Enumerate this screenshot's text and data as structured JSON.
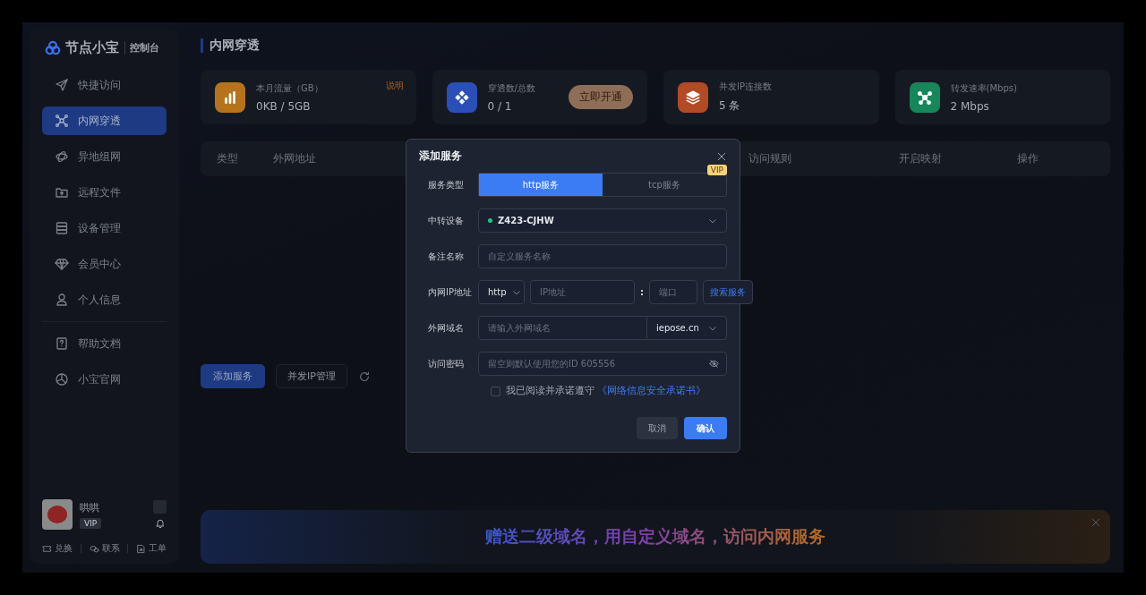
{
  "sidebar": {
    "logo": {
      "name": "节点小宝",
      "suffix": "控制台"
    },
    "items": [
      {
        "label": "快捷访问",
        "selected": false
      },
      {
        "label": "内网穿透",
        "selected": true
      },
      {
        "label": "异地组网",
        "selected": false
      },
      {
        "label": "远程文件",
        "selected": false
      },
      {
        "label": "设备管理",
        "selected": false
      },
      {
        "label": "会员中心",
        "selected": false
      },
      {
        "label": "个人信息",
        "selected": false
      }
    ],
    "help_items": [
      {
        "label": "帮助文档",
        "selected": false
      },
      {
        "label": "小宝官网",
        "selected": false
      }
    ],
    "user": {
      "name": "哄哄",
      "badge": "VIP"
    },
    "footer_links": [
      "兑换",
      "联系",
      "工单"
    ]
  },
  "page_title": "内网穿透",
  "stats": [
    {
      "label": "本月流量（GB）",
      "value": "0KB / 5GB",
      "color": "#b5741b",
      "action_link": "说明"
    },
    {
      "label": "穿透数/总数",
      "value": "0 / 1",
      "color": "#2b4fb8",
      "action_button": "立即开通"
    },
    {
      "label": "并发IP连接数",
      "value": "5 条",
      "color": "#b24a26"
    },
    {
      "label": "转发速率(Mbps)",
      "value": "2 Mbps",
      "color": "#17865a"
    }
  ],
  "table": {
    "columns": [
      "类型",
      "外网地址",
      "访问规则",
      "开启映射",
      "操作"
    ]
  },
  "actions": {
    "add_button": "添加服务",
    "ip_button": "并发IP管理"
  },
  "banner": {
    "text": "赠送二级域名，用自定义域名，访问内网服务"
  },
  "dialog": {
    "title": "添加服务",
    "service_type": {
      "label": "服务类型",
      "options": [
        {
          "label": "http服务",
          "selected": true
        },
        {
          "label": "tcp服务",
          "selected": false,
          "badge": "VIP"
        }
      ]
    },
    "relay_device": {
      "label": "中转设备",
      "value": "Z423-CJHW",
      "online": true
    },
    "remark": {
      "label": "备注名称",
      "placeholder": "自定义服务名称"
    },
    "lan_ip": {
      "label": "内网IP地址",
      "protocol": "http",
      "ip_placeholder": "IP地址",
      "separator": ":",
      "port_placeholder": "端口",
      "search_button": "搜索服务"
    },
    "domain": {
      "label": "外网域名",
      "placeholder": "请输入外网域名",
      "suffix": "iepose.cn"
    },
    "password": {
      "label": "访问密码",
      "placeholder": "留空则默认使用您的ID 605556"
    },
    "agreement": {
      "text": "我已阅读并承诺遵守",
      "link": "《网络信息安全承诺书》",
      "checked": false
    },
    "buttons": {
      "cancel": "取消",
      "confirm": "确认"
    }
  }
}
